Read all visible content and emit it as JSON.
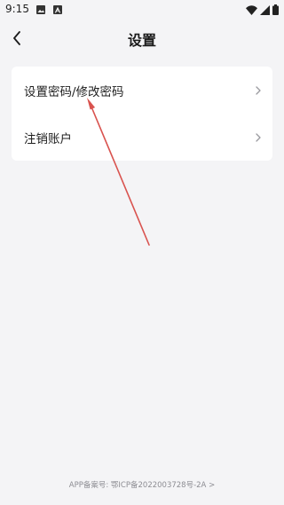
{
  "status_bar": {
    "time": "9:15",
    "icons": [
      "image-icon",
      "a-notification-icon",
      "wifi-icon",
      "signal-icon",
      "battery-icon"
    ]
  },
  "header": {
    "title": "设置",
    "back_icon": "chevron-left-icon"
  },
  "menu": {
    "items": [
      {
        "label": "设置密码/修改密码",
        "icon": "chevron-right-icon"
      },
      {
        "label": "注销账户",
        "icon": "chevron-right-icon"
      }
    ]
  },
  "footer": {
    "text": "APP备案号: 鄂ICP备2022003728号-2A  >"
  },
  "annotation": {
    "arrow_color": "#d9534f"
  },
  "colors": {
    "background": "#f4f4f6",
    "card": "#ffffff",
    "chevron": "#9a9a9f"
  }
}
